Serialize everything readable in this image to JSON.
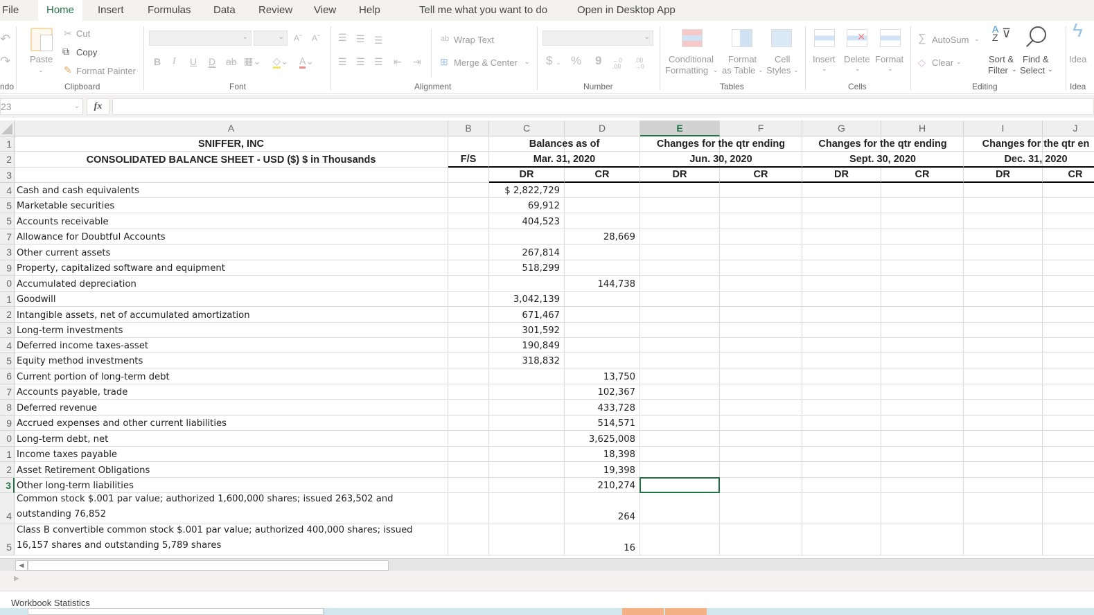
{
  "menu": {
    "tabs": [
      "File",
      "Home",
      "Insert",
      "Formulas",
      "Data",
      "Review",
      "View",
      "Help"
    ],
    "active_tab": "Home",
    "tell_me": "Tell me what you want to do",
    "open_desktop": "Open in Desktop App"
  },
  "ribbon": {
    "undo": {
      "group_label": "ndo"
    },
    "clipboard": {
      "paste": "Paste",
      "cut": "Cut",
      "copy": "Copy",
      "format_painter": "Format Painter",
      "group_label": "Clipboard"
    },
    "font": {
      "font_name": "",
      "font_size": "",
      "group_label": "Font"
    },
    "alignment": {
      "wrap_text": "Wrap Text",
      "merge_center": "Merge & Center",
      "group_label": "Alignment"
    },
    "number": {
      "format": "",
      "currency": "$",
      "percent": "%",
      "comma": "9",
      "group_label": "Number"
    },
    "tables": {
      "conditional_formatting_1": "Conditional",
      "conditional_formatting_2": "Formatting",
      "format_table_1": "Format",
      "format_table_2": "as Table",
      "cell_styles_1": "Cell",
      "cell_styles_2": "Styles",
      "group_label": "Tables"
    },
    "cells": {
      "insert": "Insert",
      "delete": "Delete",
      "format": "Format",
      "group_label": "Cells"
    },
    "editing": {
      "autosum": "AutoSum",
      "clear": "Clear",
      "sort_filter_1": "Sort &",
      "sort_filter_2": "Filter",
      "find_select_1": "Find &",
      "find_select_2": "Select",
      "group_label": "Editing"
    },
    "ideas": {
      "label": "Idea",
      "group_label": "Idea"
    }
  },
  "formula_bar": {
    "name_box": "23",
    "fx": "fx",
    "formula": ""
  },
  "columns": [
    "A",
    "B",
    "C",
    "D",
    "E",
    "F",
    "G",
    "H",
    "I",
    "J"
  ],
  "selected_column": "E",
  "selected_row": "3",
  "sheet": {
    "title1": "SNIFFER, INC",
    "title2": "CONSOLIDATED BALANCE SHEET - USD ($) $ in Thousands",
    "fs_label": "F/S",
    "periods": [
      {
        "line1": "Balances as of",
        "line2": "Mar. 31, 2020"
      },
      {
        "line1": "Changes for the qtr ending",
        "line2": "Jun. 30, 2020"
      },
      {
        "line1": "Changes for the qtr ending",
        "line2": "Sept. 30, 2020"
      },
      {
        "line1": "Changes for the qtr en",
        "line2": "Dec. 31, 2020"
      }
    ],
    "dr": "DR",
    "cr": "CR",
    "row_numbers": [
      "1",
      "2",
      "3",
      "4",
      "5",
      "5",
      "7",
      "3",
      "9",
      "0",
      "1",
      "2",
      "3",
      "4",
      "5",
      "6",
      "7",
      "8",
      "9",
      "0",
      "1",
      "2",
      "3",
      "4",
      "5"
    ],
    "rows": [
      {
        "label": "Cash and cash equivalents",
        "dr": "$ 2,822,729",
        "cr": ""
      },
      {
        "label": "Marketable securities",
        "dr": "69,912",
        "cr": ""
      },
      {
        "label": "Accounts receivable",
        "dr": "404,523",
        "cr": ""
      },
      {
        "label": "Allowance for Doubtful Accounts",
        "dr": "",
        "cr": "28,669"
      },
      {
        "label": "Other current assets",
        "dr": "267,814",
        "cr": ""
      },
      {
        "label": "Property, capitalized software and equipment",
        "dr": "518,299",
        "cr": ""
      },
      {
        "label": "Accumulated depreciation",
        "dr": "",
        "cr": "144,738"
      },
      {
        "label": "Goodwill",
        "dr": "3,042,139",
        "cr": ""
      },
      {
        "label": "Intangible assets, net of accumulated amortization",
        "dr": "671,467",
        "cr": ""
      },
      {
        "label": "Long-term investments",
        "dr": "301,592",
        "cr": ""
      },
      {
        "label": "Deferred income taxes-asset",
        "dr": "190,849",
        "cr": ""
      },
      {
        "label": "Equity method investments",
        "dr": "318,832",
        "cr": ""
      },
      {
        "label": "Current portion of long-term debt",
        "dr": "",
        "cr": "13,750"
      },
      {
        "label": "Accounts payable, trade",
        "dr": "",
        "cr": "102,367"
      },
      {
        "label": "Deferred revenue",
        "dr": "",
        "cr": "433,728"
      },
      {
        "label": "Accrued expenses and other current liabilities",
        "dr": "",
        "cr": "514,571"
      },
      {
        "label": "Long-term debt, net",
        "dr": "",
        "cr": "3,625,008"
      },
      {
        "label": "Income taxes payable",
        "dr": "",
        "cr": "18,398"
      },
      {
        "label": "Asset Retirement Obligations",
        "dr": "",
        "cr": "19,398"
      },
      {
        "label": "Other long-term liabilities",
        "dr": "",
        "cr": "210,274"
      },
      {
        "label": "Common stock $.001 par value; authorized 1,600,000 shares; issued 263,502  and outstanding 76,852",
        "dr": "",
        "cr": "264"
      },
      {
        "label": "Class B convertible common stock $.001 par value; authorized 400,000 shares; issued 16,157 shares and outstanding 5,789 shares",
        "dr": "",
        "cr": "16"
      }
    ]
  },
  "status": {
    "workbook_statistics": "Workbook Statistics"
  }
}
